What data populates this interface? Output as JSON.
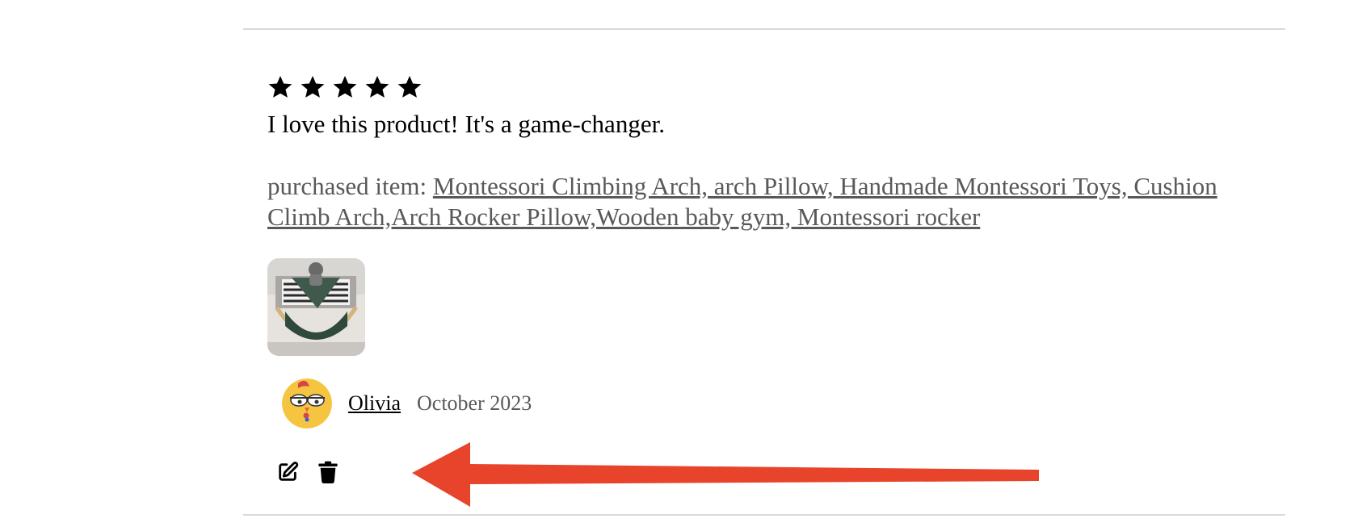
{
  "review": {
    "rating": 5,
    "rating_max": 5,
    "text": "I love this product! It's a game-changer.",
    "purchased_prefix": "purchased item: ",
    "purchased_item": "Montessori Climbing Arch, arch Pillow, Handmade Montessori Toys, Cushion Climb Arch,Arch Rocker Pillow,Wooden baby gym, Montessori rocker",
    "photo_icon": "product-photo",
    "author": {
      "name": "Olivia",
      "avatar_icon": "cartoon-bird-avatar"
    },
    "date": "October 2023",
    "actions": {
      "edit_icon": "edit-icon",
      "delete_icon": "trash-icon"
    }
  },
  "annotation": {
    "type": "arrow",
    "color": "#e8432b",
    "points_to": "review-actions"
  },
  "colors": {
    "text": "#000000",
    "muted": "#595959",
    "divider": "#d9d9d9",
    "avatar_bg": "#f5c542"
  }
}
